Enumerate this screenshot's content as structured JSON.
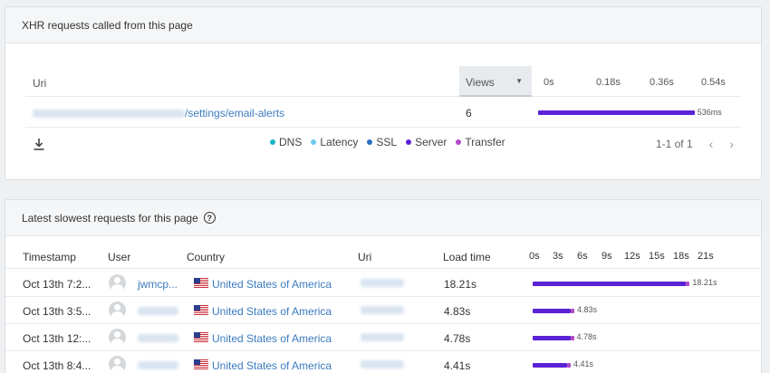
{
  "xhr": {
    "title": "XHR requests called from this page",
    "columns": {
      "uri": "Uri",
      "views": "Views"
    },
    "ticks": [
      "0s",
      "0.18s",
      "0.36s",
      "0.54s"
    ],
    "row": {
      "uri_suffix": "/settings/email-alerts",
      "views": "6",
      "duration_label": "536ms",
      "duration_s": 0.536
    },
    "axis_max_s": 0.54,
    "legend": [
      {
        "label": "DNS",
        "color": "#1ab3c8"
      },
      {
        "label": "Latency",
        "color": "#6fc6ef"
      },
      {
        "label": "SSL",
        "color": "#2a6fc2"
      },
      {
        "label": "Server",
        "color": "#5b22d6"
      },
      {
        "label": "Transfer",
        "color": "#b24ac9"
      }
    ],
    "pager": {
      "text": "1-1 of 1",
      "prev": "‹",
      "next": "›"
    }
  },
  "slowest": {
    "title": "Latest slowest requests for this page",
    "columns": {
      "timestamp": "Timestamp",
      "user": "User",
      "country": "Country",
      "uri": "Uri",
      "load": "Load time"
    },
    "ticks": [
      "0s",
      "3s",
      "6s",
      "9s",
      "12s",
      "15s",
      "18s",
      "21s"
    ],
    "axis_max_s": 21,
    "rows": [
      {
        "timestamp": "Oct 13th 7:2...",
        "user": "jwmcp...",
        "country": "United States of America",
        "load": "18.21s",
        "load_s": 18.21,
        "bar_label": "18.21s"
      },
      {
        "timestamp": "Oct 13th 3:5...",
        "user": "",
        "country": "United States of America",
        "load": "4.83s",
        "load_s": 4.83,
        "bar_label": "4.83s"
      },
      {
        "timestamp": "Oct 13th 12:...",
        "user": "",
        "country": "United States of America",
        "load": "4.78s",
        "load_s": 4.78,
        "bar_label": "4.78s"
      },
      {
        "timestamp": "Oct 13th 8:4...",
        "user": "",
        "country": "United States of America",
        "load": "4.41s",
        "load_s": 4.41,
        "bar_label": "4.41s"
      }
    ]
  },
  "colors": {
    "server": "#5b22d6",
    "transfer": "#b24ac9",
    "link": "#3b7bbf"
  }
}
